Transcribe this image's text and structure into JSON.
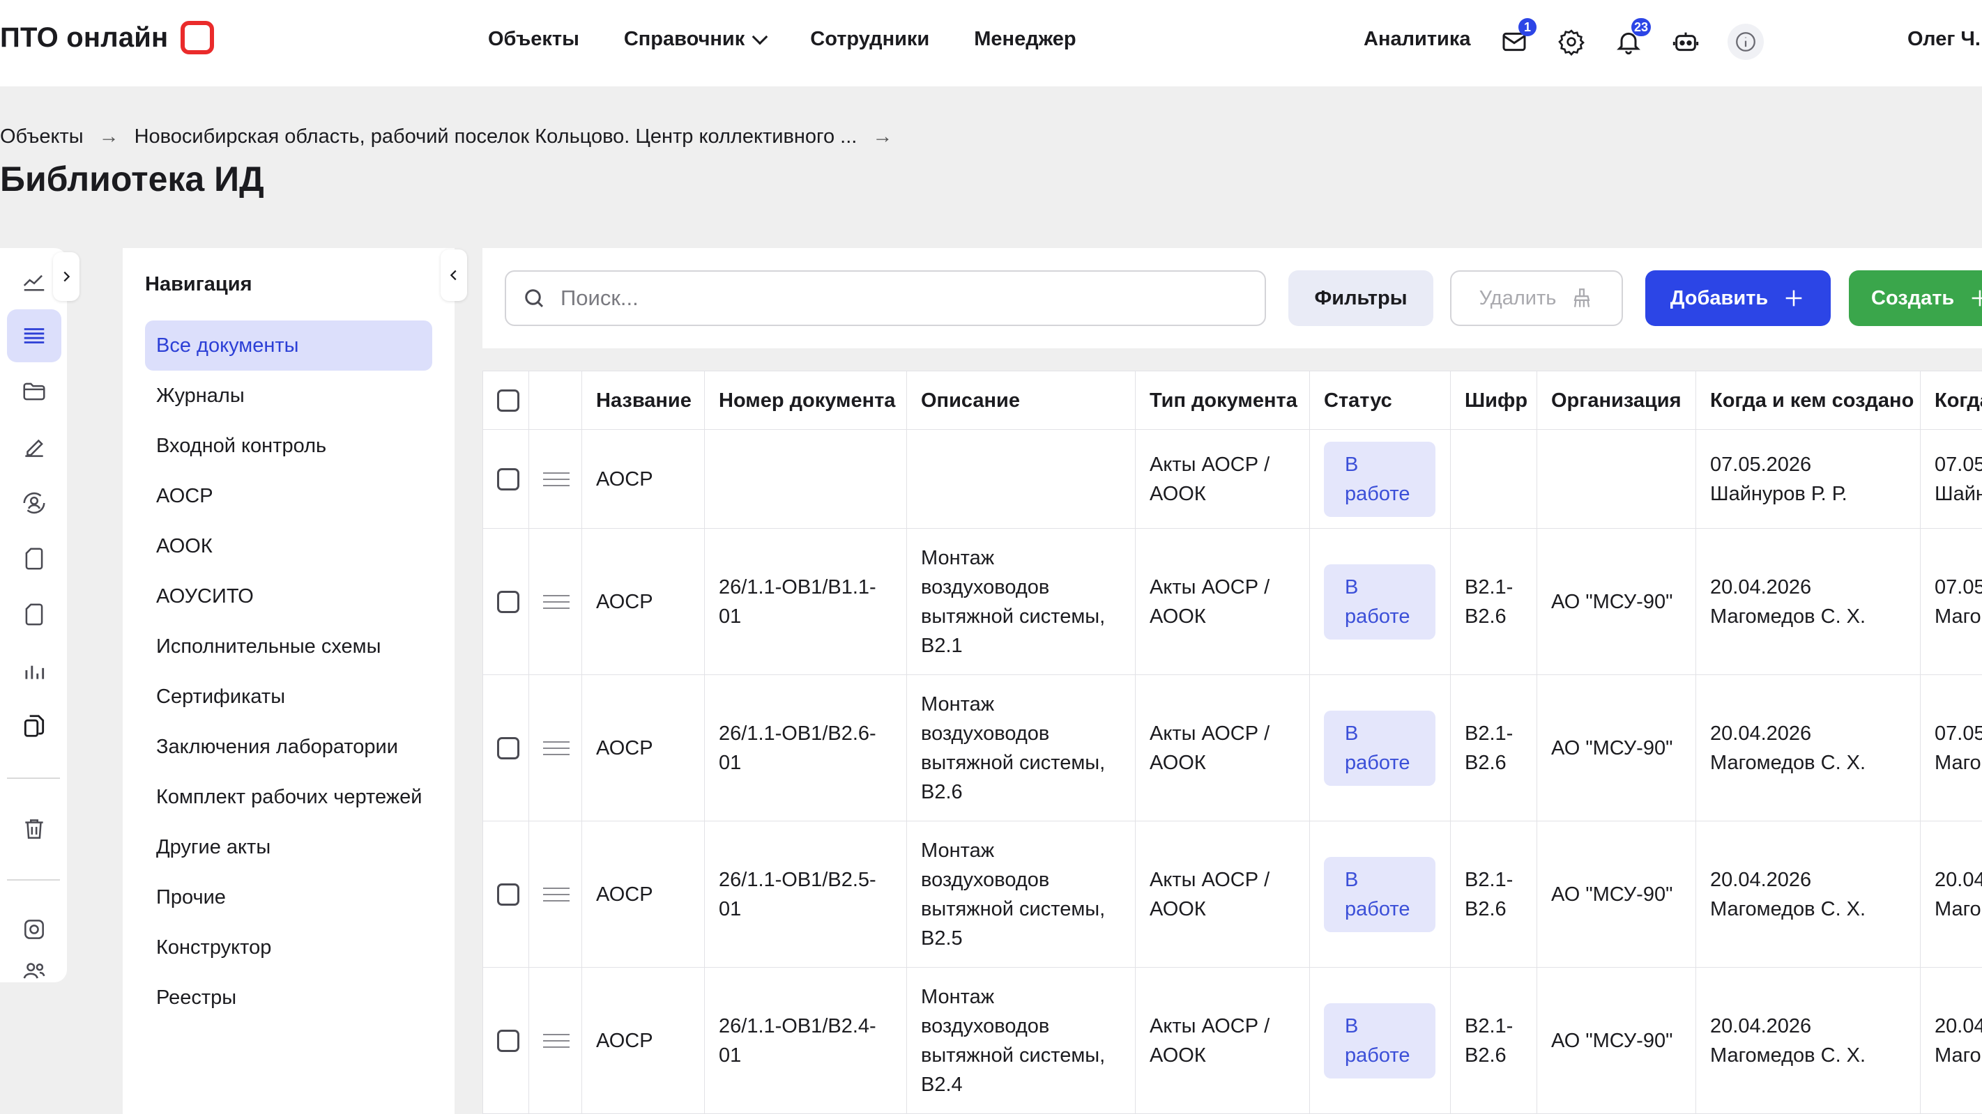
{
  "header": {
    "logo_text": "ПТО онлайн",
    "nav": [
      "Объекты",
      "Справочник",
      "Сотрудники",
      "Менеджер"
    ],
    "analytics": "Аналитика",
    "mail_badge": "1",
    "bell_badge": "23",
    "user": "Олег Ч."
  },
  "breadcrumb": {
    "root": "Объекты",
    "arrow": "→",
    "object": "Новосибирская область, рабочий поселок Кольцово. Центр коллективного ..."
  },
  "page_title": "Библиотека ИД",
  "navpanel": {
    "title": "Навигация",
    "items": [
      "Все документы",
      "Журналы",
      "Входной контроль",
      "АОСР",
      "АООК",
      "АОУСИТО",
      "Исполнительные схемы",
      "Сертификаты",
      "Заключения лаборатории",
      "Комплект рабочих чертежей",
      "Другие акты",
      "Прочие",
      "Конструктор",
      "Реестры"
    ]
  },
  "toolbar": {
    "search_placeholder": "Поиск...",
    "filters": "Фильтры",
    "delete": "Удалить",
    "add": "Добавить",
    "create": "Создать"
  },
  "table": {
    "columns": [
      "Название",
      "Номер документа",
      "Описание",
      "Тип документа",
      "Статус",
      "Шифр",
      "Организация",
      "Когда и кем создано",
      "Когда"
    ],
    "rows": [
      {
        "name": "АОСР",
        "number": "",
        "description": "",
        "type": "Акты АОСР / АООК",
        "status": "В работе",
        "code": "",
        "org": "",
        "created": "07.05.2026 Шайнуров Р. Р.",
        "updated": "07.05 Шайн"
      },
      {
        "name": "АОСР",
        "number": "26/1.1-ОВ1/В1.1-01",
        "description": "Монтаж воздуховодов вытяжной системы, В2.1",
        "type": "Акты АОСР / АООК",
        "status": "В работе",
        "code": "В2.1-В2.6",
        "org": "АО \"МСУ-90\"",
        "created": "20.04.2026 Магомедов С. Х.",
        "updated": "07.05 Маго"
      },
      {
        "name": "АОСР",
        "number": "26/1.1-ОВ1/В2.6-01",
        "description": "Монтаж воздуховодов вытяжной системы, В2.6",
        "type": "Акты АОСР / АООК",
        "status": "В работе",
        "code": "В2.1-В2.6",
        "org": "АО \"МСУ-90\"",
        "created": "20.04.2026 Магомедов С. Х.",
        "updated": "07.05 Маго"
      },
      {
        "name": "АОСР",
        "number": "26/1.1-ОВ1/В2.5-01",
        "description": "Монтаж воздуховодов вытяжной системы, В2.5",
        "type": "Акты АОСР / АООК",
        "status": "В работе",
        "code": "В2.1-В2.6",
        "org": "АО \"МСУ-90\"",
        "created": "20.04.2026 Магомедов С. Х.",
        "updated": "20.04 Маго"
      },
      {
        "name": "АОСР",
        "number": "26/1.1-ОВ1/В2.4-01",
        "description": "Монтаж воздуховодов вытяжной системы, В2.4",
        "type": "Акты АОСР / АООК",
        "status": "В работе",
        "code": "В2.1-В2.6",
        "org": "АО \"МСУ-90\"",
        "created": "20.04.2026 Магомедов С. Х.",
        "updated": "20.04 Маго"
      }
    ]
  },
  "colors": {
    "accent": "#2c45e6",
    "create": "#3aa64b",
    "logo": "#ea2b2b",
    "active_bg": "#dcdffb"
  }
}
